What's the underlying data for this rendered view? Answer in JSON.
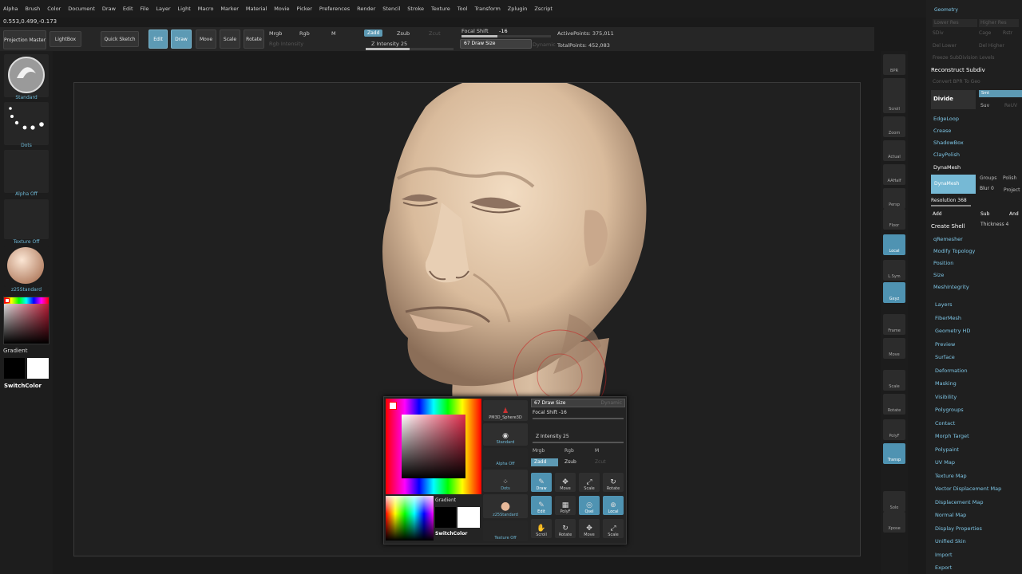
{
  "menu": [
    "Alpha",
    "Brush",
    "Color",
    "Document",
    "Draw",
    "Edit",
    "File",
    "Layer",
    "Light",
    "Macro",
    "Marker",
    "Material",
    "Movie",
    "Picker",
    "Preferences",
    "Render",
    "Stencil",
    "Stroke",
    "Texture",
    "Tool",
    "Transform",
    "Zplugin",
    "Zscript"
  ],
  "coords": "0.553,0.499,-0.173",
  "toolbar": {
    "projection_master": "Projection Master",
    "lightbox": "LightBox",
    "quick_sketch": "Quick Sketch",
    "edit": "Edit",
    "draw": "Draw",
    "move": "Move",
    "scale": "Scale",
    "rotate": "Rotate",
    "mrgb": "Mrgb",
    "rgb": "Rgb",
    "m": "M",
    "rgb_intensity": "Rgb Intensity",
    "zadd": "Zadd",
    "zsub": "Zsub",
    "zcut": "Zcut",
    "z_intensity": "Z Intensity 25",
    "focal_shift": "Focal Shift",
    "focal_value": "-16",
    "draw_size": "67 Draw Size",
    "dynamic": "Dynamic",
    "active_points": "ActivePoints: 375,011",
    "total_points": "TotalPoints: 452,083"
  },
  "left": {
    "brush": "Standard",
    "stroke": "Dots",
    "alpha": "Alpha Off",
    "texture": "Texture Off",
    "material": "z25Standard",
    "gradient": "Gradient",
    "switch_color": "SwitchColor"
  },
  "right_shelf": [
    "BPR",
    "SPix 3",
    "Scroll",
    "Zoom",
    "Actual",
    "AAHalf",
    "Persp",
    "Floor",
    "Local",
    "L.Sym",
    "Gxyz",
    "Frame",
    "Move",
    "Scale",
    "Rotate",
    "PolyF",
    "Transp",
    "Solo",
    "Xpose"
  ],
  "right_panel": {
    "geometry": "Geometry",
    "lower_res": "Lower Res",
    "higher_res": "Higher Res",
    "sdiv": "SDiv",
    "cage": "Cage",
    "rstr": "Rstr",
    "del_lower": "Del Lower",
    "del_higher": "Del Higher",
    "freeze": "Freeze SubDivision Levels",
    "reconstruct": "Reconstruct Subdiv",
    "convert": "Convert BPR To Geo",
    "divide": "Divide",
    "smt": "Smt",
    "suv": "Suv",
    "reuv": "ReUV",
    "edgeloop": "EdgeLoop",
    "crease": "Crease",
    "shadowbox": "ShadowBox",
    "claypolish": "ClayPolish",
    "dynamesh_header": "DynaMesh",
    "dynamesh": "DynaMesh",
    "groups": "Groups",
    "polish": "Polish",
    "blur": "Blur 0",
    "project": "Project",
    "resolution": "Resolution 368",
    "add": "Add",
    "sub": "Sub",
    "and": "And",
    "create_shell": "Create Shell",
    "thickness": "Thickness 4",
    "qremesher": "qRemesher",
    "modify_topology": "Modify Topology",
    "position": "Position",
    "size": "Size",
    "meshintegrity": "MeshIntegrity",
    "subpalettes": [
      "Layers",
      "FiberMesh",
      "Geometry HD",
      "Preview",
      "Surface",
      "Deformation",
      "Masking",
      "Visibility",
      "Polygroups",
      "Contact",
      "Morph Target",
      "Polypaint",
      "UV Map",
      "Texture Map",
      "Vector Displacement Map",
      "Displacement Map",
      "Normal Map",
      "Display Properties",
      "Unified Skin",
      "Import",
      "Export"
    ]
  },
  "popup": {
    "draw_size": "67 Draw Size",
    "dynamic": "Dynamic",
    "focal_shift": "Focal Shift -16",
    "z_intensity": "Z Intensity 25",
    "mrgb": "Mrgb",
    "rgb": "Rgb",
    "m": "M",
    "zadd": "Zadd",
    "zsub": "Zsub",
    "zcut": "Zcut",
    "pm3d": "PM3D_Sphere3D",
    "brush": "Standard",
    "alpha": "Alpha Off",
    "stroke": "Dots",
    "material": "z25Standard",
    "texture": "Texture Off",
    "gradient": "Gradient",
    "switch_color": "SwitchColor",
    "btns_row1": [
      "Draw",
      "Move",
      "Scale",
      "Rotate"
    ],
    "btns_row2": [
      "Edit",
      "PolyF",
      "Qsel",
      "Local"
    ],
    "btns_row3": [
      "Scroll",
      "Rotate",
      "Move",
      "Scale"
    ]
  },
  "colors": {
    "accent": "#5d9ab4",
    "skin": "#e2c9ad",
    "label_blue": "#7ec6e6"
  }
}
